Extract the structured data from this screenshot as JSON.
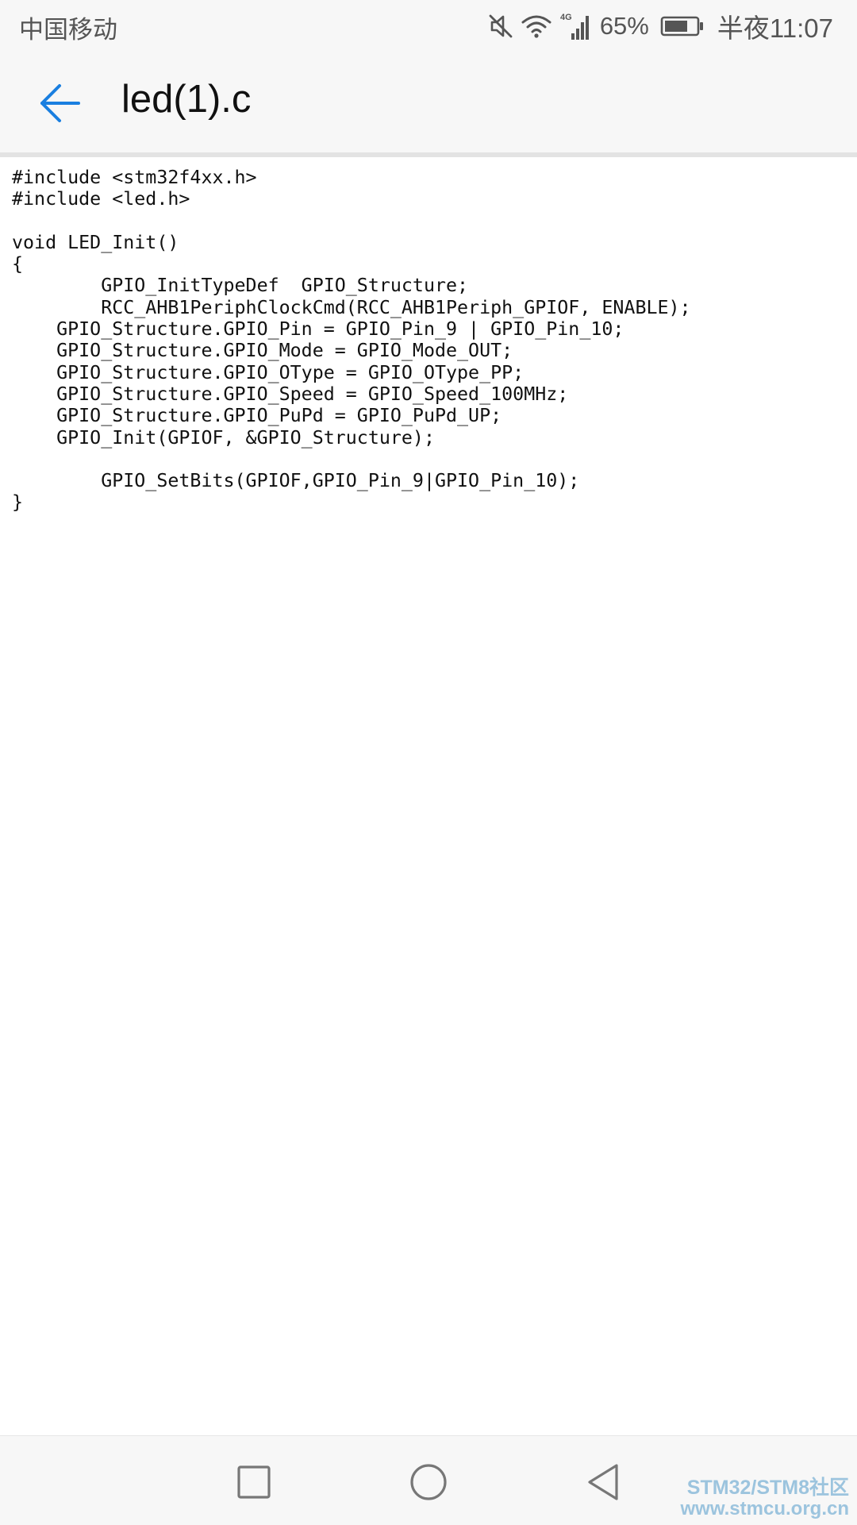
{
  "status_bar": {
    "carrier": "中国移动",
    "network_type": "4G",
    "battery_percent": "65%",
    "time": "半夜11:07",
    "icons": [
      "mute-icon",
      "wifi-icon",
      "cellular-signal-icon",
      "battery-icon"
    ]
  },
  "app_bar": {
    "title": "led(1).c",
    "back_icon": "arrow-left-icon",
    "accent_color": "#1a7fe0"
  },
  "file": {
    "lines": [
      "#include <stm32f4xx.h>",
      "#include <led.h>",
      "",
      "void LED_Init()",
      "{",
      "        GPIO_InitTypeDef  GPIO_Structure;",
      "        RCC_AHB1PeriphClockCmd(RCC_AHB1Periph_GPIOF, ENABLE);",
      "    GPIO_Structure.GPIO_Pin = GPIO_Pin_9 | GPIO_Pin_10;",
      "    GPIO_Structure.GPIO_Mode = GPIO_Mode_OUT;",
      "    GPIO_Structure.GPIO_OType = GPIO_OType_PP;",
      "    GPIO_Structure.GPIO_Speed = GPIO_Speed_100MHz;",
      "    GPIO_Structure.GPIO_PuPd = GPIO_PuPd_UP;",
      "    GPIO_Init(GPIOF, &GPIO_Structure);",
      "",
      "        GPIO_SetBits(GPIOF,GPIO_Pin_9|GPIO_Pin_10);",
      "}"
    ]
  },
  "nav_bar": {
    "buttons": [
      "recent-apps-icon",
      "home-icon",
      "back-triangle-icon"
    ]
  },
  "watermark": {
    "line1": "STM32/STM8社区",
    "line2": "www.stmcu.org.cn"
  }
}
